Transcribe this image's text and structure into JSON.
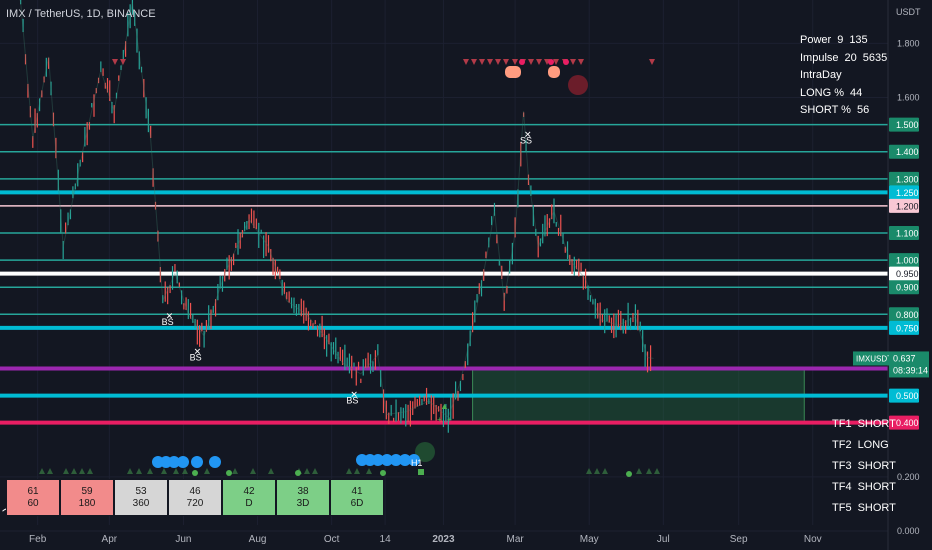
{
  "header": {
    "symbol_title": "IMX / TetherUS, 1D, BINANCE"
  },
  "axis": {
    "currency": "USDT"
  },
  "stats": [
    {
      "label": "Power",
      "v1": "9",
      "v2": "135"
    },
    {
      "label": "Impulse",
      "v1": "20",
      "v2": "5635"
    },
    {
      "label": "IntraDay",
      "v1": "",
      "v2": ""
    },
    {
      "label": "LONG %",
      "v1": "44",
      "v2": ""
    },
    {
      "label": "SHORT %",
      "v1": "56",
      "v2": ""
    }
  ],
  "timeframes": [
    {
      "label": "TF1",
      "signal": "SHORT"
    },
    {
      "label": "TF2",
      "signal": "LONG"
    },
    {
      "label": "TF3",
      "signal": "SHORT"
    },
    {
      "label": "TF4",
      "signal": "SHORT"
    },
    {
      "label": "TF5",
      "signal": "SHORT"
    }
  ],
  "tf_boxes": [
    {
      "top": "61",
      "bottom": "60",
      "color": "#f28b8b"
    },
    {
      "top": "59",
      "bottom": "180",
      "color": "#f28b8b"
    },
    {
      "top": "53",
      "bottom": "360",
      "color": "#d6d6d6"
    },
    {
      "top": "46",
      "bottom": "720",
      "color": "#d6d6d6"
    },
    {
      "top": "42",
      "bottom": "D",
      "color": "#7dcf87"
    },
    {
      "top": "38",
      "bottom": "3D",
      "color": "#7dcf87"
    },
    {
      "top": "41",
      "bottom": "6D",
      "color": "#7dcf87"
    }
  ],
  "chart_data": {
    "type": "line",
    "title": "IMX / TetherUS, 1D, BINANCE",
    "xlabel": "",
    "ylabel": "USDT",
    "ylim": [
      -0.07,
      1.96
    ],
    "price_ticks": [
      0.0,
      0.2,
      1.6,
      1.8
    ],
    "time_ticks": [
      "Feb",
      "Apr",
      "Jun",
      "Aug",
      "Oct",
      "14",
      "2023",
      "Mar",
      "May",
      "Jul",
      "Sep",
      "Nov"
    ],
    "price_path": [
      {
        "d": "2022-01-03",
        "p": 2.3
      },
      {
        "d": "2022-01-18",
        "p": 1.95
      },
      {
        "d": "2022-01-28",
        "p": 1.45
      },
      {
        "d": "2022-02-10",
        "p": 1.75
      },
      {
        "d": "2022-02-22",
        "p": 1.05
      },
      {
        "d": "2022-03-10",
        "p": 1.4
      },
      {
        "d": "2022-03-25",
        "p": 1.7
      },
      {
        "d": "2022-04-05",
        "p": 1.55
      },
      {
        "d": "2022-04-20",
        "p": 1.95
      },
      {
        "d": "2022-05-05",
        "p": 1.45
      },
      {
        "d": "2022-05-15",
        "p": 0.85
      },
      {
        "d": "2022-05-25",
        "p": 0.95
      },
      {
        "d": "2022-06-05",
        "p": 0.8
      },
      {
        "d": "2022-06-18",
        "p": 0.72
      },
      {
        "d": "2022-07-05",
        "p": 0.95
      },
      {
        "d": "2022-07-25",
        "p": 1.15
      },
      {
        "d": "2022-08-10",
        "p": 1.05
      },
      {
        "d": "2022-08-25",
        "p": 0.85
      },
      {
        "d": "2022-09-10",
        "p": 0.8
      },
      {
        "d": "2022-09-25",
        "p": 0.72
      },
      {
        "d": "2022-10-10",
        "p": 0.62
      },
      {
        "d": "2022-10-25",
        "p": 0.58
      },
      {
        "d": "2022-11-08",
        "p": 0.65
      },
      {
        "d": "2022-11-15",
        "p": 0.43
      },
      {
        "d": "2022-12-01",
        "p": 0.44
      },
      {
        "d": "2022-12-20",
        "p": 0.48
      },
      {
        "d": "2023-01-05",
        "p": 0.42
      },
      {
        "d": "2023-01-15",
        "p": 0.55
      },
      {
        "d": "2023-01-25",
        "p": 0.75
      },
      {
        "d": "2023-02-05",
        "p": 1.0
      },
      {
        "d": "2023-02-12",
        "p": 1.18
      },
      {
        "d": "2023-02-20",
        "p": 0.85
      },
      {
        "d": "2023-03-01",
        "p": 1.1
      },
      {
        "d": "2023-03-08",
        "p": 1.55
      },
      {
        "d": "2023-03-12",
        "p": 1.3
      },
      {
        "d": "2023-03-20",
        "p": 1.05
      },
      {
        "d": "2023-04-02",
        "p": 1.18
      },
      {
        "d": "2023-04-15",
        "p": 1.0
      },
      {
        "d": "2023-04-28",
        "p": 0.93
      },
      {
        "d": "2023-05-10",
        "p": 0.78
      },
      {
        "d": "2023-05-25",
        "p": 0.76
      },
      {
        "d": "2023-06-08",
        "p": 0.79
      },
      {
        "d": "2023-06-18",
        "p": 0.64
      },
      {
        "d": "2023-06-23",
        "p": 0.637
      }
    ],
    "horizontal_levels": [
      {
        "price": 1.5,
        "label": "1.500",
        "color": "#26a69a",
        "width": 1.5
      },
      {
        "price": 1.4,
        "label": "1.400",
        "color": "#26a69a",
        "width": 1.5
      },
      {
        "price": 1.3,
        "label": "1.300",
        "color": "#26a69a",
        "width": 1.5
      },
      {
        "price": 1.25,
        "label": "1.250",
        "color": "#00bcd4",
        "width": 4
      },
      {
        "price": 1.2,
        "label": "1.200",
        "color": "#f8c8d4",
        "width": 1.5
      },
      {
        "price": 1.1,
        "label": "1.100",
        "color": "#26a69a",
        "width": 1.5
      },
      {
        "price": 1.0,
        "label": "1.000",
        "color": "#26a69a",
        "width": 1.5
      },
      {
        "price": 0.95,
        "label": "0.950",
        "color": "#ffffff",
        "width": 4
      },
      {
        "price": 0.9,
        "label": "0.900",
        "color": "#26a69a",
        "width": 1.5
      },
      {
        "price": 0.8,
        "label": "0.800",
        "color": "#26a69a",
        "width": 1.5
      },
      {
        "price": 0.75,
        "label": "0.750",
        "color": "#00bcd4",
        "width": 4
      },
      {
        "price": 0.6,
        "label": "0.600",
        "color": "#9c27b0",
        "width": 4
      },
      {
        "price": 0.5,
        "label": "0.500",
        "color": "#00bcd4",
        "width": 4
      },
      {
        "price": 0.4,
        "label": "0.400",
        "color": "#e91e63",
        "width": 4
      }
    ],
    "current_price": {
      "symbol": "IMXUSDT",
      "price": "0.637",
      "countdown": "08:39:14"
    },
    "zone": {
      "date_start": "2023-01-25",
      "date_end": "2023-10-25",
      "price_low": 0.4,
      "price_high": 0.595
    },
    "markers": [
      {
        "date": "2022-05-19",
        "price": 0.76,
        "text": "BS"
      },
      {
        "date": "2022-06-11",
        "price": 0.63,
        "text": "BS"
      },
      {
        "date": "2022-10-18",
        "price": 0.47,
        "text": "BS"
      },
      {
        "date": "2023-03-10",
        "price": 1.43,
        "text": "SS"
      },
      {
        "date": "2022-12-10",
        "price": 0.24,
        "text": "H1"
      }
    ]
  }
}
